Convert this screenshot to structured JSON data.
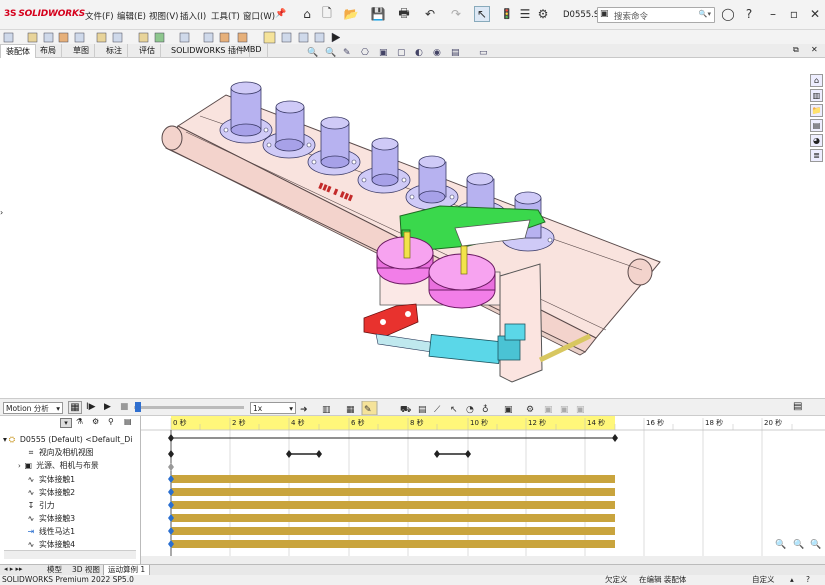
{
  "app": {
    "brand": "SOLIDWORKS",
    "menus": [
      "文件(F)",
      "编辑(E)",
      "视图(V)",
      "插入(I)",
      "工具(T)",
      "窗口(W)"
    ],
    "doc_name": "D0555.S...",
    "search_placeholder": "搜索命令"
  },
  "tabs": [
    "装配体",
    "布局",
    "草图",
    "标注",
    "评估",
    "SOLIDWORKS 插件",
    "MBD"
  ],
  "active_tab": "装配体",
  "motion": {
    "study_type": "Motion 分析",
    "speed": "1x",
    "ruler_labels": [
      "0 秒",
      "2 秒",
      "4 秒",
      "6 秒",
      "8 秒",
      "10 秒",
      "12 秒",
      "14 秒",
      "16 秒",
      "18 秒",
      "20 秒"
    ]
  },
  "tree": {
    "root": "D0555 (Default) <Default_Di",
    "items": [
      "视向及相机视图",
      "光源、相机与布景",
      "实体接触1",
      "实体接触2",
      "引力",
      "实体接触3",
      "线性马达1",
      "实体接触4"
    ]
  },
  "bottom_tabs": [
    "模型",
    "3D 视图",
    "运动算例 1"
  ],
  "active_bottom_tab": "运动算例 1",
  "status": {
    "product": "SOLIDWORKS Premium 2022 SP5.0",
    "state1": "欠定义",
    "state2": "在编辑 装配体",
    "state3": "自定义"
  },
  "colors": {
    "accent_red": "#d5001c",
    "timeline_bar": "#c9a43d",
    "ruler_yellow": "#fff77a",
    "part_purple": "#b7b2f0",
    "conveyor_pink": "#f9e3de",
    "gear_magenta": "#f27ee8",
    "bracket_green": "#38d848",
    "cylinder_cyan": "#5bd7e8",
    "red_part": "#e8322e"
  }
}
